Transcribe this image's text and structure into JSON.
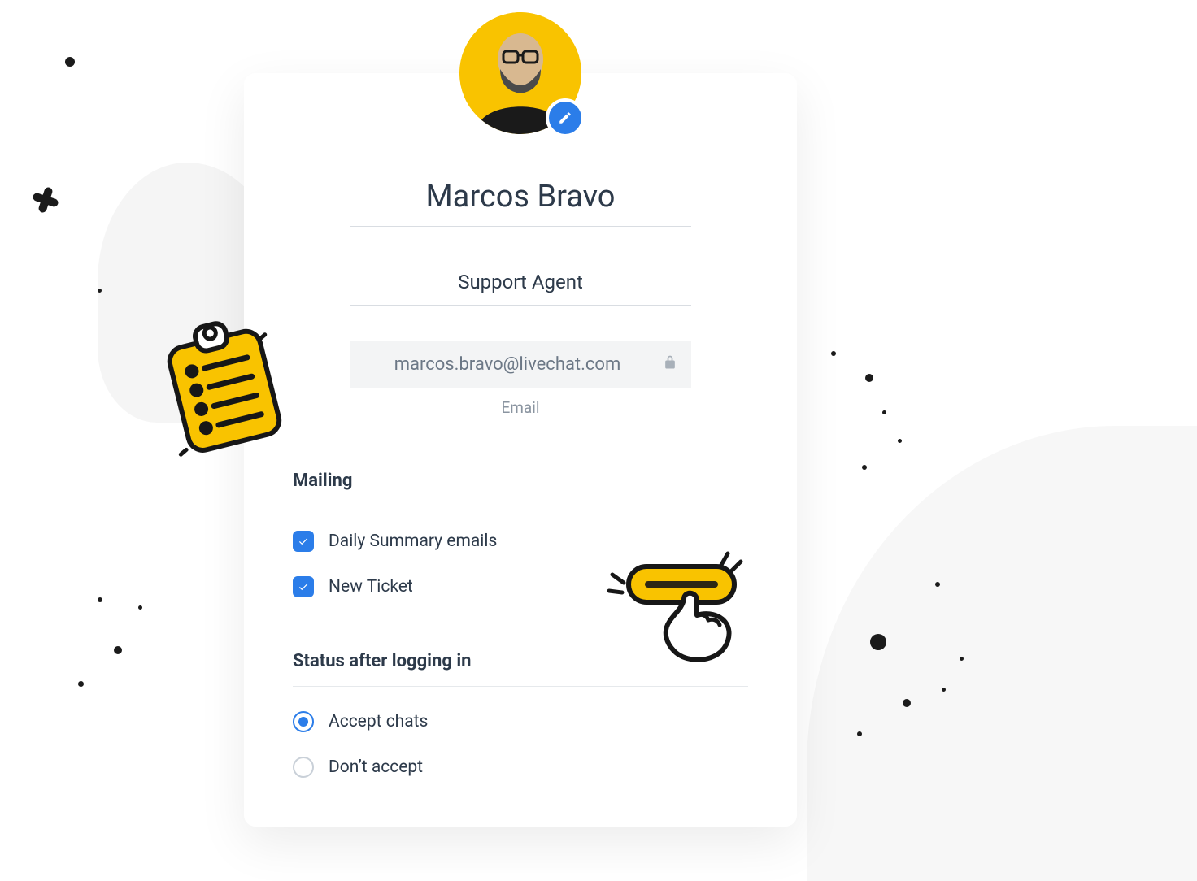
{
  "profile": {
    "name": "Marcos Bravo",
    "role": "Support Agent",
    "email": "marcos.bravo@livechat.com",
    "email_label": "Email"
  },
  "sections": {
    "mailing": {
      "title": "Mailing",
      "options": [
        {
          "label": "Daily Summary emails",
          "checked": true
        },
        {
          "label": "New Ticket",
          "checked": true
        }
      ]
    },
    "status": {
      "title": "Status after logging in",
      "options": [
        {
          "label": "Accept chats",
          "selected": true
        },
        {
          "label": "Don’t accept",
          "selected": false
        }
      ]
    }
  },
  "colors": {
    "accent": "#2b7de9",
    "avatar_bg": "#f9c300",
    "illustration_yellow": "#f9c300"
  },
  "icons": {
    "edit": "pencil-icon",
    "lock": "lock-icon",
    "check": "check-icon"
  }
}
